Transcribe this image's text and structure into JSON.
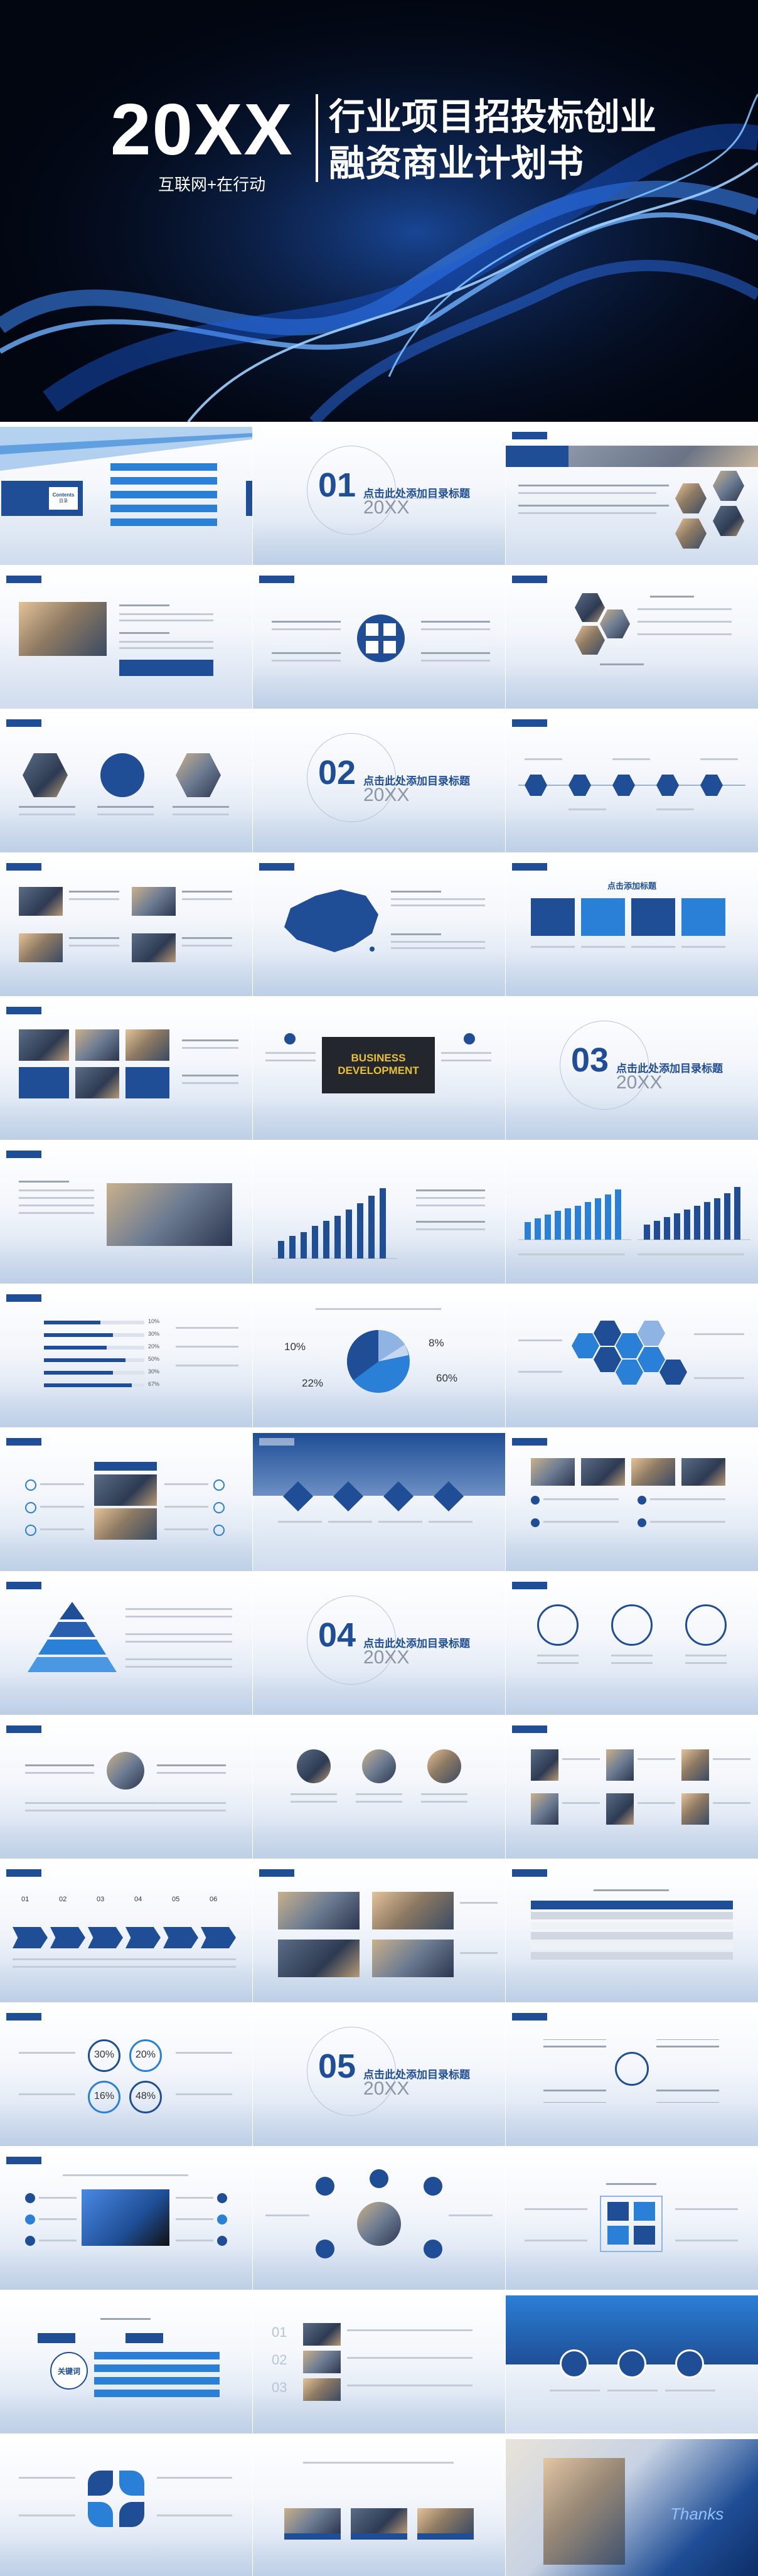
{
  "hero": {
    "year": "20XX",
    "tagline": "互联网+在行动",
    "title_line1": "行业项目招投标创业",
    "title_line2": "融资商业计划书"
  },
  "contents_slide": {
    "word": "Contents",
    "word_cn": "目录"
  },
  "section_slides": [
    {
      "number": "01",
      "title": "点击此处添加目录标题",
      "sub": "20XX"
    },
    {
      "number": "02",
      "title": "点击此处添加目录标题",
      "sub": "20XX"
    },
    {
      "number": "03",
      "title": "点击此处添加目录标题",
      "sub": "20XX"
    },
    {
      "number": "04",
      "title": "点击此处添加目录标题",
      "sub": "20XX"
    },
    {
      "number": "05",
      "title": "点击此处添加目录标题",
      "sub": "20XX"
    }
  ],
  "heading_text": "点击添加标题",
  "business_dev": {
    "line1": "BUSINESS",
    "line2": "DEVELOPMENT"
  },
  "pie_percents": [
    "10%",
    "8%",
    "22%",
    "60%"
  ],
  "circle_percents": [
    "30%",
    "20%",
    "16%",
    "48%"
  ],
  "step_numbers": [
    "01",
    "02",
    "03",
    "04",
    "05",
    "06"
  ],
  "bar_percents": [
    "10%",
    "30%",
    "20%",
    "50%",
    "30%",
    "67%"
  ],
  "keyword": "关键词",
  "thanks": "Thanks",
  "colors": {
    "navy": "#1f4e96",
    "blue": "#2a7fd6",
    "light": "#8fb3e2"
  }
}
